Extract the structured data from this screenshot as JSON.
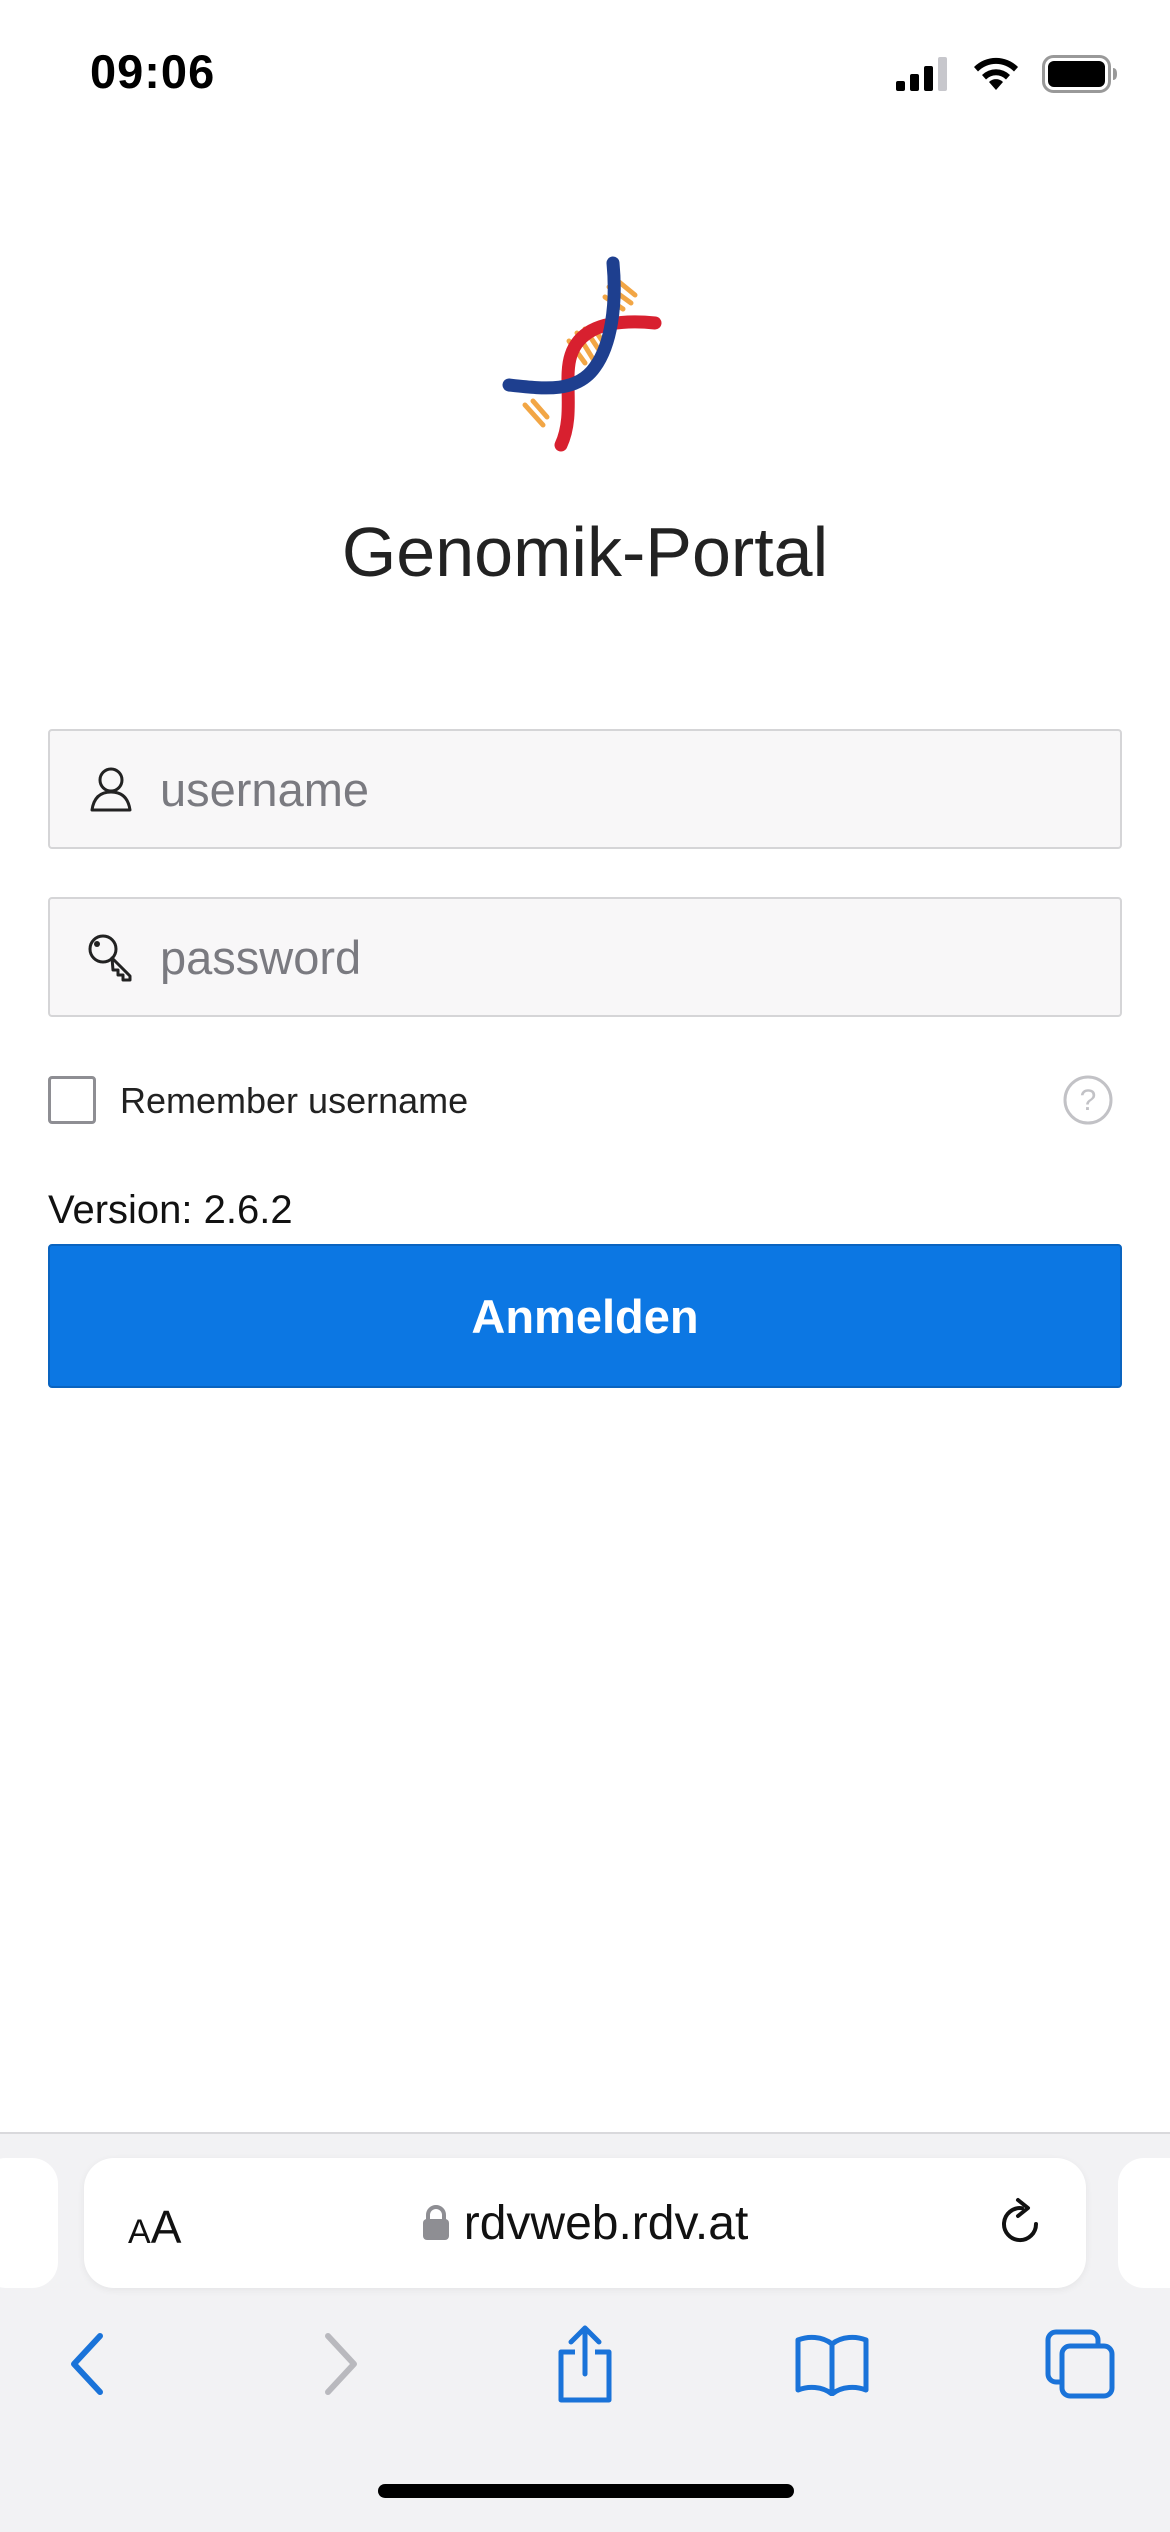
{
  "status_bar": {
    "time": "09:06"
  },
  "app": {
    "title": "Genomik-Portal"
  },
  "login": {
    "username_placeholder": "username",
    "password_placeholder": "password",
    "remember_label": "Remember username",
    "version": "Version: 2.6.2",
    "submit_label": "Anmelden"
  },
  "browser": {
    "text_size_label_small": "A",
    "text_size_label_large": "A",
    "url": "rdvweb.rdv.at"
  },
  "colors": {
    "primary_button": "#0c77e3",
    "browser_accent": "#1a73d9",
    "dna_red": "#d8202f",
    "dna_blue": "#1e3f8f",
    "dna_orange": "#f2a23c"
  }
}
